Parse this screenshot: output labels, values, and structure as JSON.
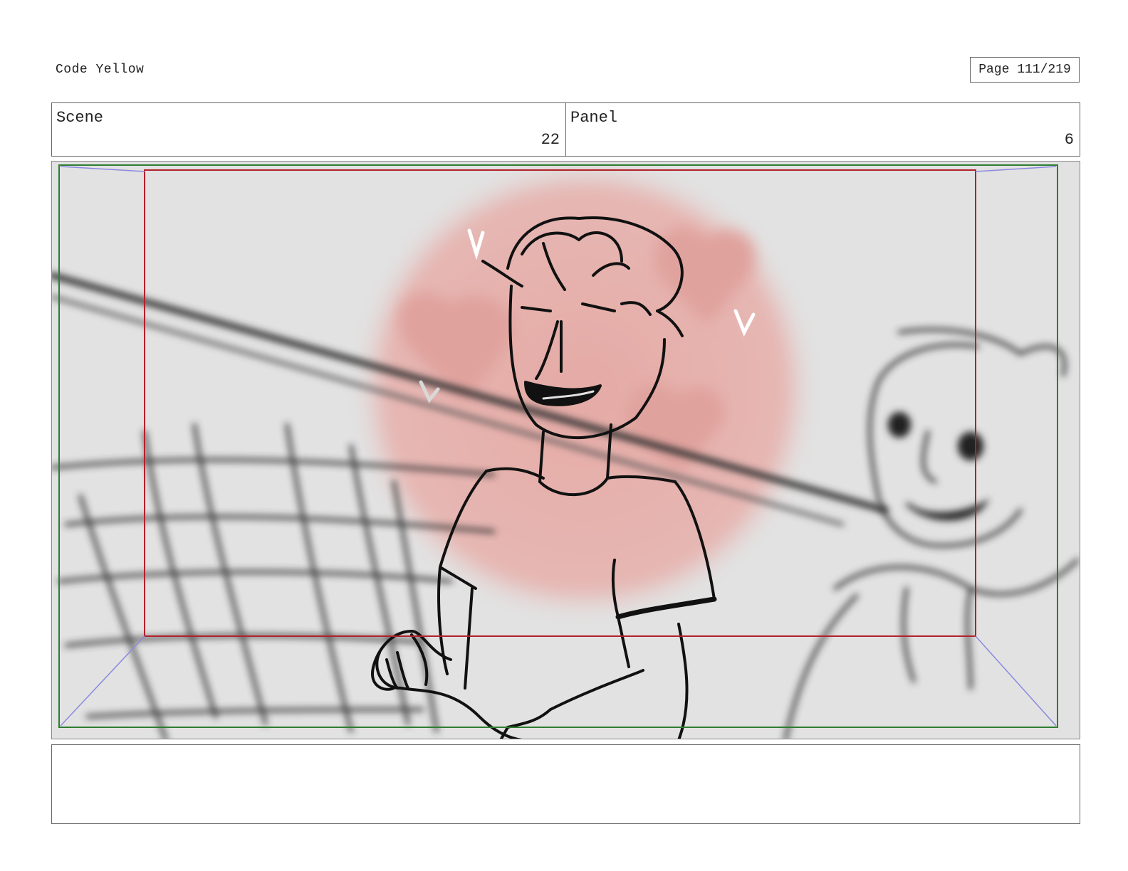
{
  "header": {
    "project_title": "Code Yellow",
    "page_label": "Page 111/219"
  },
  "fields": {
    "scene_label": "Scene",
    "scene_value": "22",
    "panel_label": "Panel",
    "panel_value": "6"
  },
  "notes": {
    "text": ""
  },
  "colors": {
    "safe_area_outer": "#2e7d32",
    "safe_area_inner": "#b3202a",
    "guide_lines": "#8a8ae0",
    "heart_bg": "#e7b3ae"
  }
}
